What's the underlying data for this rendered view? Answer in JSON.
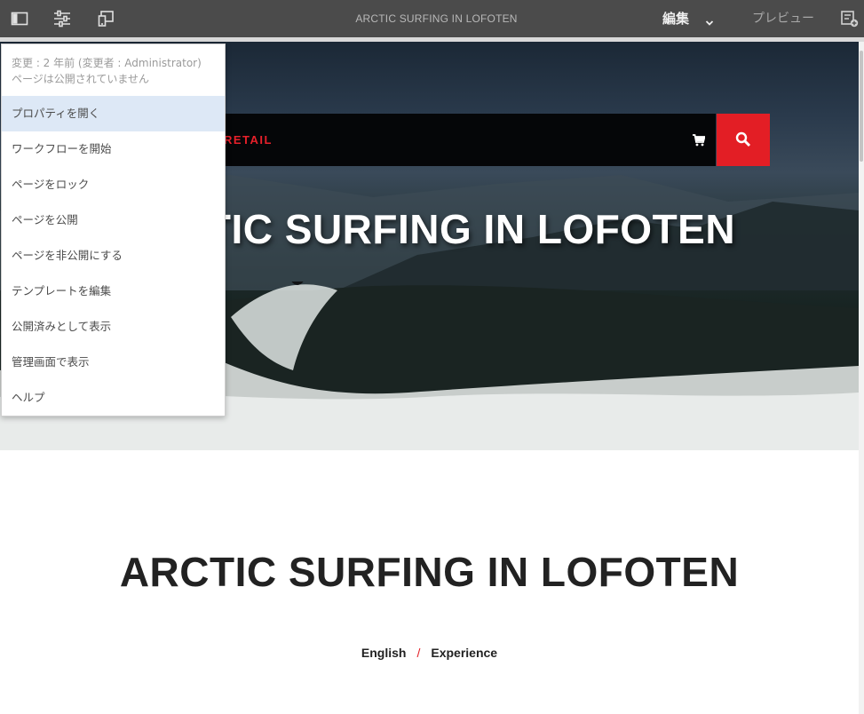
{
  "toolbar": {
    "title": "ARCTIC SURFING IN LOFOTEN",
    "mode_label": "編集",
    "preview_label": "プレビュー",
    "icons": [
      "side-panel-icon",
      "page-properties-icon",
      "emulator-icon",
      "annotation-icon",
      "chevron-down-icon"
    ]
  },
  "page_info_menu": {
    "modified_text": "変更 : 2 年前 (変更者 : Administrator)",
    "publish_status": "ページは公開されていません",
    "items": [
      {
        "label": "プロパティを開く",
        "highlighted": true
      },
      {
        "label": "ワークフローを開始"
      },
      {
        "label": "ページをロック"
      },
      {
        "label": "ページを公開"
      },
      {
        "label": "ページを非公開にする"
      },
      {
        "label": "テンプレートを編集"
      },
      {
        "label": "公開済みとして表示"
      },
      {
        "label": "管理画面で表示"
      },
      {
        "label": "ヘルプ"
      }
    ]
  },
  "site": {
    "nav_brand_partial": "RETAIL",
    "hero_title_partial": "TIC SURFING IN LOFOTEN",
    "page_title": "ARCTIC SURFING IN LOFOTEN",
    "breadcrumb": [
      "English",
      "Experience"
    ],
    "breadcrumb_separator": "/",
    "icons": [
      "cart-icon",
      "search-icon"
    ]
  },
  "colors": {
    "toolbar_bg": "#4b4b4b",
    "accent_red": "#e31e25",
    "menu_highlight": "#dde8f6"
  }
}
